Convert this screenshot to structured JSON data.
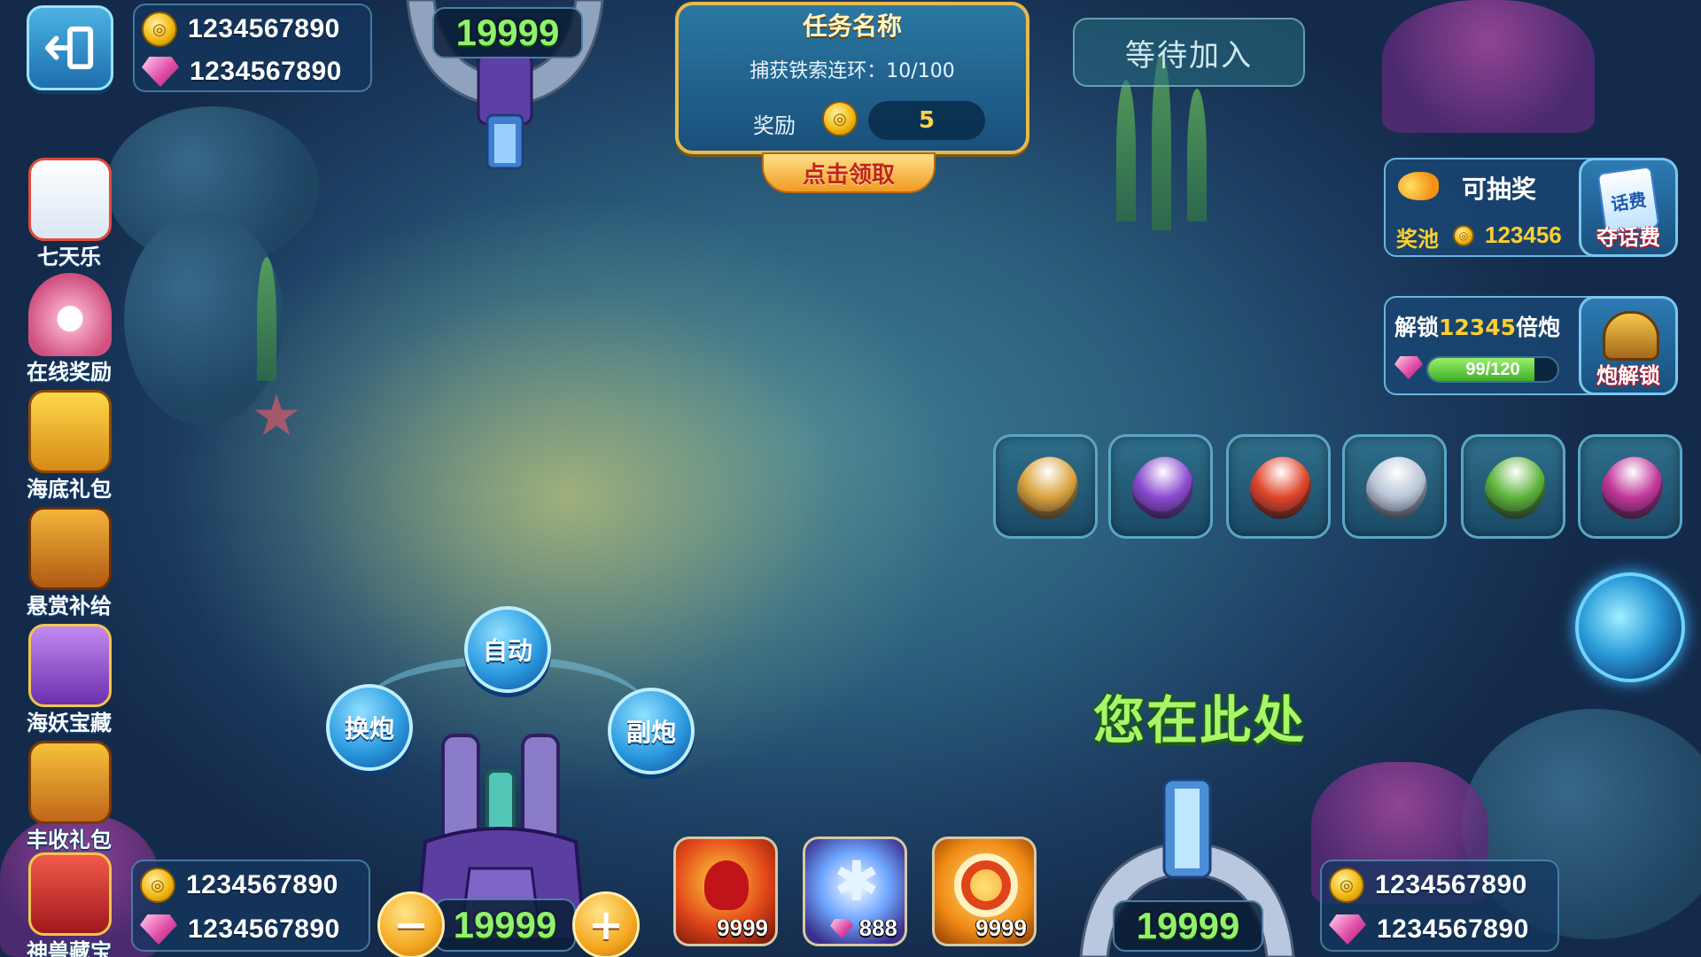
{
  "top_left_wallet": {
    "coins": "1234567890",
    "gems": "1234567890"
  },
  "top_cannon": {
    "level": "19999"
  },
  "task": {
    "title": "任务名称",
    "description": "捕获铁索连环：10/100",
    "reward_label": "奖励",
    "reward_value": "5",
    "claim_label": "点击领取"
  },
  "wait_join": {
    "label": "等待加入"
  },
  "side_menu": [
    {
      "label": "七天乐",
      "icon": "calendar-icon"
    },
    {
      "label": "在线奖励",
      "icon": "pearl-shell-icon"
    },
    {
      "label": "海底礼包",
      "icon": "gift-chest-icon"
    },
    {
      "label": "悬赏补给",
      "icon": "treasure-chest-icon"
    },
    {
      "label": "海妖宝藏",
      "icon": "purple-chest-icon"
    },
    {
      "label": "丰收礼包",
      "icon": "harvest-chest-icon"
    },
    {
      "label": "神兽藏宝",
      "icon": "red-chest-icon"
    }
  ],
  "lottery": {
    "title": "可抽奖",
    "pool_label": "奖池",
    "pool_value": "123456",
    "button_label": "夺话费",
    "card_text": "话费"
  },
  "unlock": {
    "prefix": "解锁",
    "multiplier": "12345",
    "suffix": "倍炮",
    "progress_text": "99/120",
    "progress": 0.825,
    "button_label": "炮解锁"
  },
  "torpedoes": [
    {
      "name": "gold-torpedo",
      "color": "#d9a23a"
    },
    {
      "name": "purple-torpedo",
      "color": "#8b4ad0"
    },
    {
      "name": "red-torpedo",
      "color": "#e0442a"
    },
    {
      "name": "silver-torpedo",
      "color": "#b8c4d6"
    },
    {
      "name": "green-torpedo",
      "color": "#5cb43a"
    },
    {
      "name": "magenta-torpedo",
      "color": "#c2369a"
    }
  ],
  "here_label": "您在此处",
  "controls": {
    "auto": "自动",
    "switch_cannon": "换炮",
    "sub_cannon": "副炮",
    "minus": "−",
    "plus": "+"
  },
  "player": {
    "level": "19999",
    "coins": "1234567890",
    "gems": "1234567890"
  },
  "items": [
    {
      "name": "rage-item",
      "count": "9999"
    },
    {
      "name": "freeze-item",
      "count": "888"
    },
    {
      "name": "lock-target-item",
      "count": "9999"
    }
  ],
  "bottom_right": {
    "level": "19999",
    "coins": "1234567890",
    "gems": "1234567890"
  }
}
